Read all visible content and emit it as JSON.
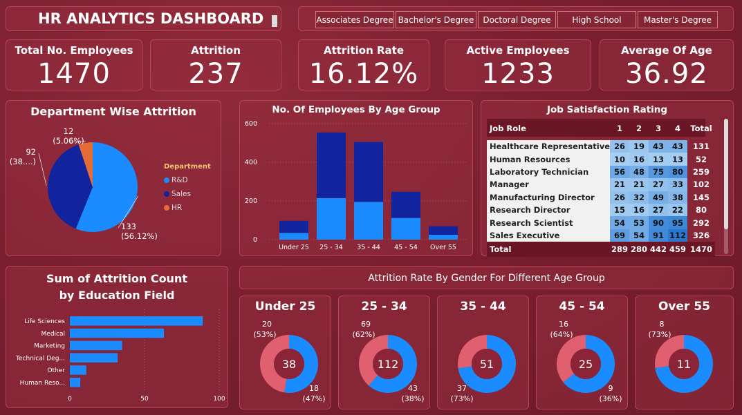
{
  "header": {
    "title": "HR ANALYTICS DASHBOARD"
  },
  "education_filter": [
    "Associates Degree",
    "Bachelor's Degree",
    "Doctoral Degree",
    "High School",
    "Master's Degree"
  ],
  "kpis": {
    "total": {
      "label": "Total No. Employees",
      "value": "1470"
    },
    "attrition": {
      "label": "Attrition",
      "value": "237"
    },
    "rate": {
      "label": "Attrition Rate",
      "value": "16.12%"
    },
    "active": {
      "label": "Active Employees",
      "value": "1233"
    },
    "age": {
      "label": "Average Of Age",
      "value": "36.92"
    }
  },
  "colors": {
    "bg": "#7a1f30",
    "card": "#962d3e",
    "light_blue": "#1a8cff",
    "dark_blue": "#12239e",
    "orange": "#e66c37",
    "pink": "#e06070",
    "legend_title": "#f2c46d"
  },
  "charts": [
    {
      "id": "dept",
      "title": "Department Wise Attrition",
      "type": "pie",
      "legend_title": "Department",
      "slices": [
        {
          "name": "R&D",
          "value": 133,
          "label_value": "133",
          "label_pct": "(56.12%)",
          "color": "#1a8cff"
        },
        {
          "name": "Sales",
          "value": 92,
          "label_value": "92",
          "label_pct": "(38....)",
          "color": "#12239e"
        },
        {
          "name": "HR",
          "value": 12,
          "label_value": "12",
          "label_pct": "(5.06%)",
          "color": "#e66c37"
        }
      ]
    },
    {
      "id": "age",
      "title": "No. Of Employees By Age Group",
      "type": "bar",
      "categories": [
        "Under 25",
        "25 - 34",
        "35 - 44",
        "45 - 54",
        "Over 55"
      ],
      "series": [
        {
          "values": [
            35,
            215,
            195,
            112,
            25
          ],
          "color": "#1a8cff"
        },
        {
          "values": [
            62,
            339,
            310,
            135,
            44
          ],
          "color": "#12239e"
        }
      ],
      "ylim": [
        0,
        600
      ],
      "yticks": [
        0,
        200,
        400,
        600
      ]
    },
    {
      "id": "edu",
      "title": "Sum of Attrition Count by Education Field",
      "type": "bar",
      "orientation": "horizontal",
      "categories": [
        "Life Sciences",
        "Medical",
        "Marketing",
        "Technical Deg...",
        "Other",
        "Human Reso..."
      ],
      "values": [
        89,
        63,
        35,
        32,
        11,
        7
      ],
      "xlim": [
        0,
        100
      ],
      "xticks": [
        0,
        50,
        100
      ],
      "color": "#1a8cff"
    },
    {
      "id": "gender",
      "title": "Attrition Rate By Gender For Different Age Group",
      "type": "pie",
      "donuts": [
        {
          "title": "Under 25",
          "total": "38",
          "values": [
            20,
            18
          ],
          "top_label": "20",
          "top_pct": "(53%)",
          "bottom_label": "18",
          "bottom_pct": "(47%)"
        },
        {
          "title": "25 - 34",
          "total": "112",
          "values": [
            69,
            43
          ],
          "top_label": "69",
          "top_pct": "(62%)",
          "bottom_label": "43",
          "bottom_pct": "(38%)"
        },
        {
          "title": "35 - 44",
          "total": "51",
          "values": [
            37,
            14
          ],
          "top_label": "",
          "top_pct": "",
          "bottom_label": "37",
          "bottom_pct": "(73%)"
        },
        {
          "title": "45 - 54",
          "total": "25",
          "values": [
            16,
            9
          ],
          "top_label": "16",
          "top_pct": "(64%)",
          "bottom_label": "9",
          "bottom_pct": "(36%)"
        },
        {
          "title": "Over 55",
          "total": "11",
          "values": [
            8,
            3
          ],
          "top_label": "8",
          "top_pct": "(73%)",
          "bottom_label": "",
          "bottom_pct": ""
        }
      ]
    },
    {
      "id": "jobsat",
      "title": "Job Satisfaction Rating",
      "type": "table",
      "headers": [
        "Job Role",
        "1",
        "2",
        "3",
        "4",
        "Total"
      ],
      "rows": [
        {
          "role": "Healthcare Representative",
          "v": [
            26,
            19,
            43,
            43
          ],
          "total": "131"
        },
        {
          "role": "Human Resources",
          "v": [
            10,
            16,
            13,
            13
          ],
          "total": "52"
        },
        {
          "role": "Laboratory Technician",
          "v": [
            56,
            48,
            75,
            80
          ],
          "total": "259"
        },
        {
          "role": "Manager",
          "v": [
            21,
            21,
            27,
            33
          ],
          "total": "102"
        },
        {
          "role": "Manufacturing Director",
          "v": [
            26,
            32,
            49,
            38
          ],
          "total": "145"
        },
        {
          "role": "Research Director",
          "v": [
            15,
            16,
            27,
            22
          ],
          "total": "80"
        },
        {
          "role": "Research Scientist",
          "v": [
            54,
            53,
            90,
            95
          ],
          "total": "292"
        },
        {
          "role": "Sales Executive",
          "v": [
            69,
            54,
            91,
            112
          ],
          "total": "326"
        }
      ],
      "total_row": {
        "label": "Total",
        "v": [
          "289",
          "280",
          "442",
          "459"
        ],
        "total": "1470"
      }
    }
  ]
}
